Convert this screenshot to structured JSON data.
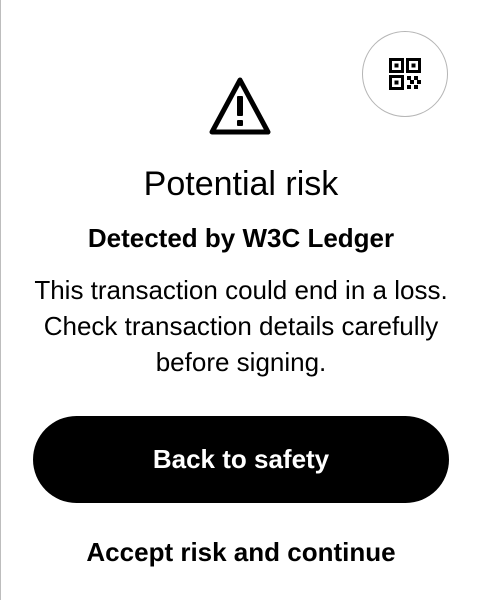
{
  "icons": {
    "qr": "qr-code-icon",
    "warning": "warning-triangle-icon"
  },
  "colors": {
    "primary_button_bg": "#000000",
    "primary_button_text": "#ffffff",
    "text": "#000000"
  },
  "alert": {
    "title": "Potential risk",
    "subtitle": "Detected by W3C Ledger",
    "description": "This transaction could end in a loss. Check transaction details carefully before signing."
  },
  "actions": {
    "primary_label": "Back to safety",
    "secondary_label": "Accept risk and continue"
  }
}
